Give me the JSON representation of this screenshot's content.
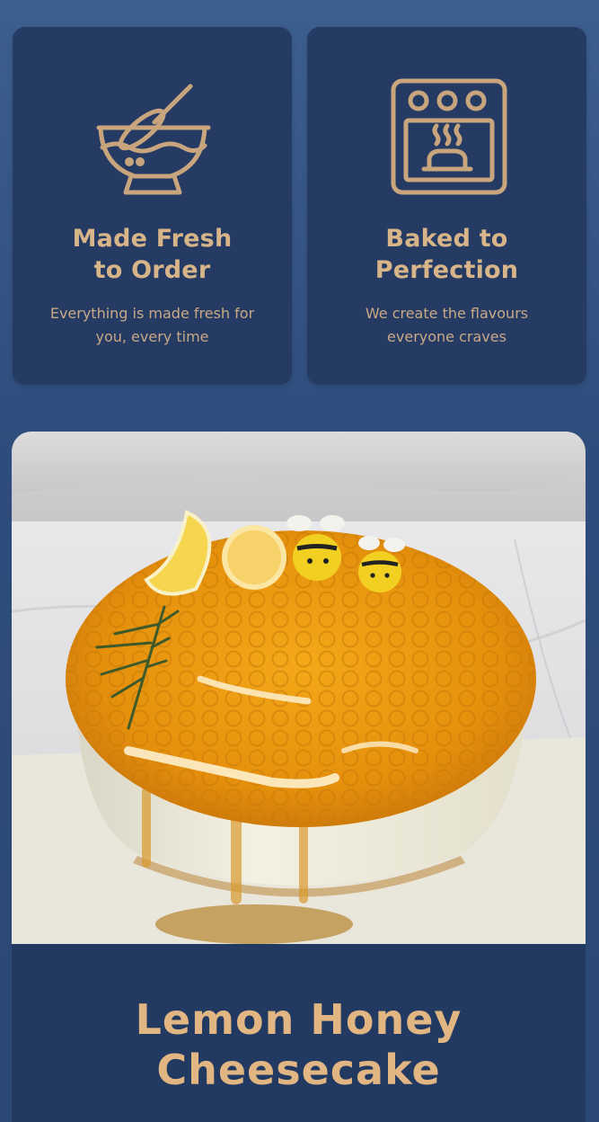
{
  "features": [
    {
      "icon": "mixing-bowl-whisk-icon",
      "title_line1": "Made Fresh",
      "title_line2": "to Order",
      "desc_line1": "Everything is made fresh for",
      "desc_line2": "you, every time"
    },
    {
      "icon": "oven-cake-icon",
      "title_line1": "Baked to",
      "title_line2": "Perfection",
      "desc_line1": "We create the flavours",
      "desc_line2": "everyone craves"
    }
  ],
  "product": {
    "name_line1": "Lemon Honey",
    "name_line2": "Cheesecake"
  },
  "colors": {
    "background": "#2f4d7c",
    "card": "#253b64",
    "accent_gold": "#d8b589"
  }
}
